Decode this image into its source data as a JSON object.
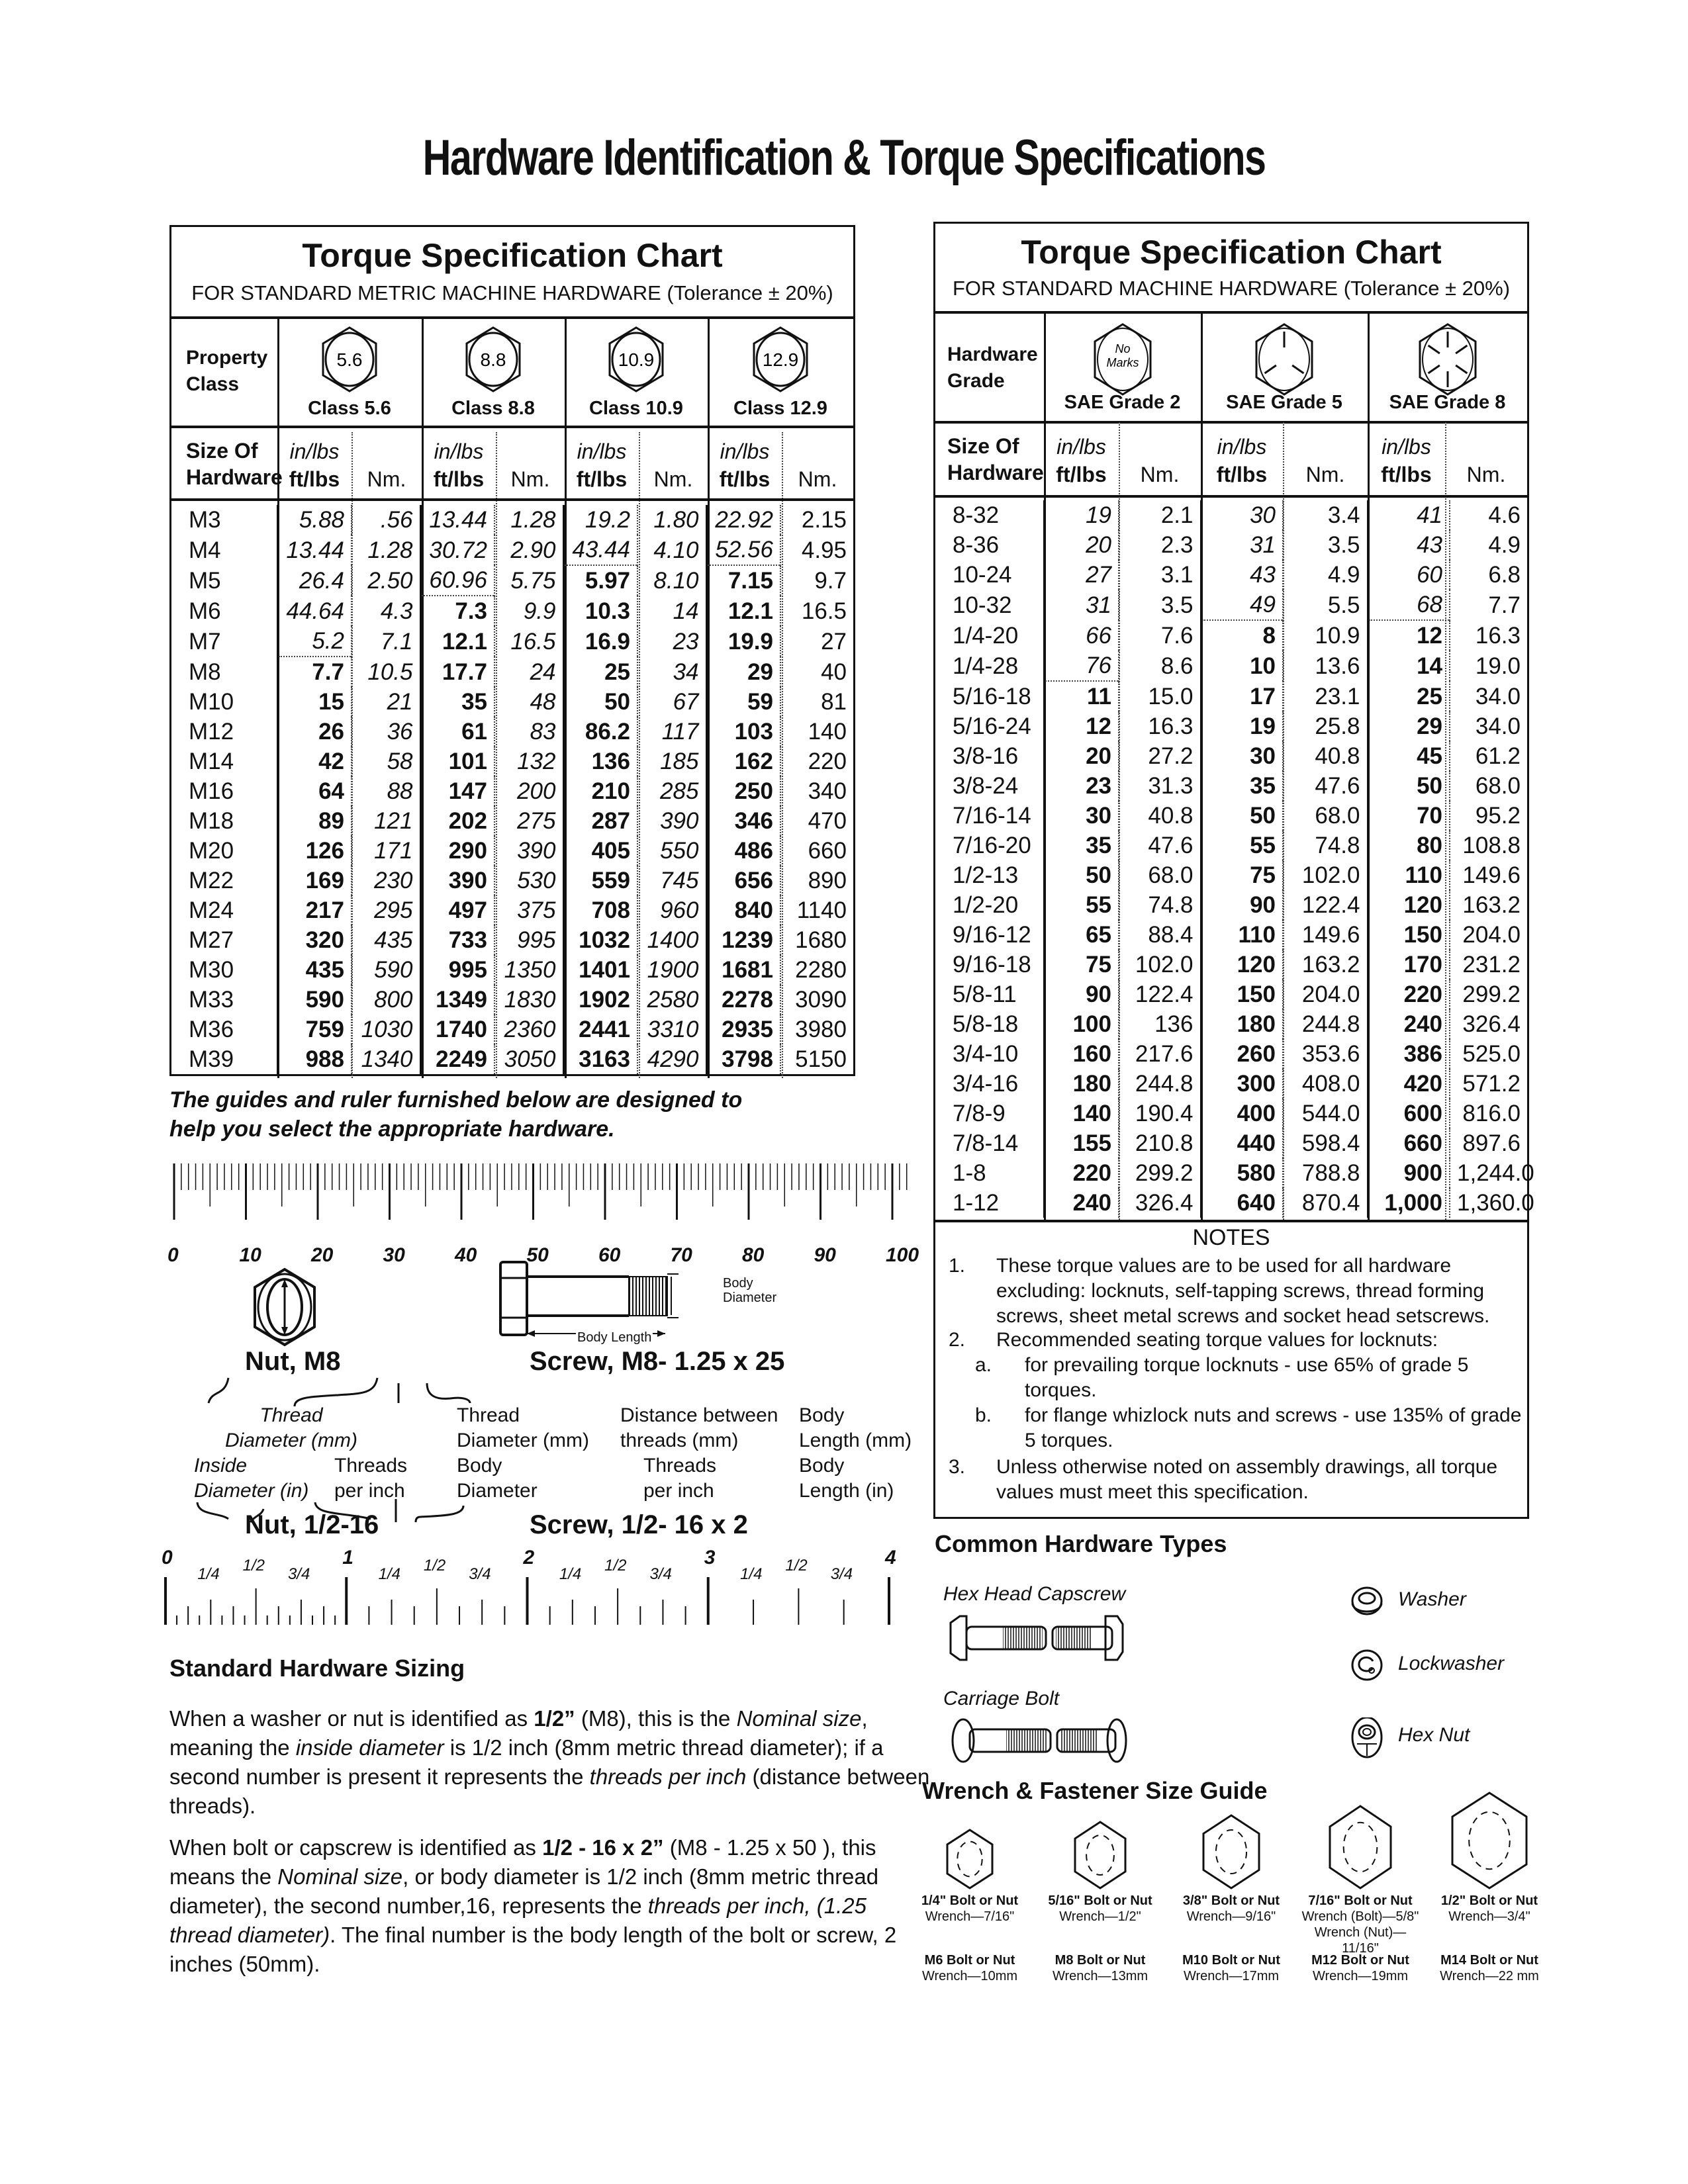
{
  "page": {
    "title": "Hardware Identification  &  Torque Specifications"
  },
  "metric": {
    "title": "Torque Specification Chart",
    "subtitle": "FOR STANDARD METRIC MACHINE HARDWARE (Tolerance ± 20%)",
    "property_label": [
      "Property",
      "Class"
    ],
    "size_label": [
      "Size Of",
      "Hardware"
    ],
    "unit_top": "in/lbs",
    "unit_bottom": "ft/lbs",
    "unit_nm": "Nm.",
    "classes": [
      {
        "mark": "5.6",
        "label": "Class 5.6"
      },
      {
        "mark": "8.8",
        "label": "Class 8.8"
      },
      {
        "mark": "10.9",
        "label": "Class 10.9"
      },
      {
        "mark": "12.9",
        "label": "Class 12.9"
      }
    ],
    "in_lbs_rows_until": [
      5,
      3,
      2,
      2
    ],
    "rows": [
      {
        "size": "M3",
        "v": [
          "5.88",
          ".56",
          "13.44",
          "1.28",
          "19.2",
          "1.80",
          "22.92",
          "2.15"
        ]
      },
      {
        "size": "M4",
        "v": [
          "13.44",
          "1.28",
          "30.72",
          "2.90",
          "43.44",
          "4.10",
          "52.56",
          "4.95"
        ]
      },
      {
        "size": "M5",
        "v": [
          "26.4",
          "2.50",
          "60.96",
          "5.75",
          "5.97",
          "8.10",
          "7.15",
          "9.7"
        ]
      },
      {
        "size": "M6",
        "v": [
          "44.64",
          "4.3",
          "7.3",
          "9.9",
          "10.3",
          "14",
          "12.1",
          "16.5"
        ]
      },
      {
        "size": "M7",
        "v": [
          "5.2",
          "7.1",
          "12.1",
          "16.5",
          "16.9",
          "23",
          "19.9",
          "27"
        ]
      },
      {
        "size": "M8",
        "v": [
          "7.7",
          "10.5",
          "17.7",
          "24",
          "25",
          "34",
          "29",
          "40"
        ]
      },
      {
        "size": "M10",
        "v": [
          "15",
          "21",
          "35",
          "48",
          "50",
          "67",
          "59",
          "81"
        ]
      },
      {
        "size": "M12",
        "v": [
          "26",
          "36",
          "61",
          "83",
          "86.2",
          "117",
          "103",
          "140"
        ]
      },
      {
        "size": "M14",
        "v": [
          "42",
          "58",
          "101",
          "132",
          "136",
          "185",
          "162",
          "220"
        ]
      },
      {
        "size": "M16",
        "v": [
          "64",
          "88",
          "147",
          "200",
          "210",
          "285",
          "250",
          "340"
        ]
      },
      {
        "size": "M18",
        "v": [
          "89",
          "121",
          "202",
          "275",
          "287",
          "390",
          "346",
          "470"
        ]
      },
      {
        "size": "M20",
        "v": [
          "126",
          "171",
          "290",
          "390",
          "405",
          "550",
          "486",
          "660"
        ]
      },
      {
        "size": "M22",
        "v": [
          "169",
          "230",
          "390",
          "530",
          "559",
          "745",
          "656",
          "890"
        ]
      },
      {
        "size": "M24",
        "v": [
          "217",
          "295",
          "497",
          "375",
          "708",
          "960",
          "840",
          "1140"
        ]
      },
      {
        "size": "M27",
        "v": [
          "320",
          "435",
          "733",
          "995",
          "1032",
          "1400",
          "1239",
          "1680"
        ]
      },
      {
        "size": "M30",
        "v": [
          "435",
          "590",
          "995",
          "1350",
          "1401",
          "1900",
          "1681",
          "2280"
        ]
      },
      {
        "size": "M33",
        "v": [
          "590",
          "800",
          "1349",
          "1830",
          "1902",
          "2580",
          "2278",
          "3090"
        ]
      },
      {
        "size": "M36",
        "v": [
          "759",
          "1030",
          "1740",
          "2360",
          "2441",
          "3310",
          "2935",
          "3980"
        ]
      },
      {
        "size": "M39",
        "v": [
          "988",
          "1340",
          "2249",
          "3050",
          "3163",
          "4290",
          "3798",
          "5150"
        ]
      }
    ]
  },
  "sae": {
    "title": "Torque Specification Chart",
    "subtitle": "FOR STANDARD MACHINE HARDWARE (Tolerance ± 20%)",
    "grade_label": [
      "Hardware",
      "Grade"
    ],
    "size_label": [
      "Size Of",
      "Hardware"
    ],
    "unit_top": "in/lbs",
    "unit_bottom": "ft/lbs",
    "unit_nm": "Nm.",
    "no_marks": [
      "No",
      "Marks"
    ],
    "grades": [
      {
        "label": "SAE Grade 2",
        "icon": "no-marks"
      },
      {
        "label": "SAE Grade 5",
        "icon": "three-lines"
      },
      {
        "label": "SAE Grade 8",
        "icon": "six-lines"
      }
    ],
    "in_lbs_rows_until": [
      6,
      4,
      4
    ],
    "rows": [
      {
        "size": "8-32",
        "v": [
          "19",
          "2.1",
          "30",
          "3.4",
          "41",
          "4.6"
        ]
      },
      {
        "size": "8-36",
        "v": [
          "20",
          "2.3",
          "31",
          "3.5",
          "43",
          "4.9"
        ]
      },
      {
        "size": "10-24",
        "v": [
          "27",
          "3.1",
          "43",
          "4.9",
          "60",
          "6.8"
        ]
      },
      {
        "size": "10-32",
        "v": [
          "31",
          "3.5",
          "49",
          "5.5",
          "68",
          "7.7"
        ]
      },
      {
        "size": "1/4-20",
        "v": [
          "66",
          "7.6",
          "8",
          "10.9",
          "12",
          "16.3"
        ]
      },
      {
        "size": "1/4-28",
        "v": [
          "76",
          "8.6",
          "10",
          "13.6",
          "14",
          "19.0"
        ]
      },
      {
        "size": "5/16-18",
        "v": [
          "11",
          "15.0",
          "17",
          "23.1",
          "25",
          "34.0"
        ]
      },
      {
        "size": "5/16-24",
        "v": [
          "12",
          "16.3",
          "19",
          "25.8",
          "29",
          "34.0"
        ]
      },
      {
        "size": "3/8-16",
        "v": [
          "20",
          "27.2",
          "30",
          "40.8",
          "45",
          "61.2"
        ]
      },
      {
        "size": "3/8-24",
        "v": [
          "23",
          "31.3",
          "35",
          "47.6",
          "50",
          "68.0"
        ]
      },
      {
        "size": "7/16-14",
        "v": [
          "30",
          "40.8",
          "50",
          "68.0",
          "70",
          "95.2"
        ]
      },
      {
        "size": "7/16-20",
        "v": [
          "35",
          "47.6",
          "55",
          "74.8",
          "80",
          "108.8"
        ]
      },
      {
        "size": "1/2-13",
        "v": [
          "50",
          "68.0",
          "75",
          "102.0",
          "110",
          "149.6"
        ]
      },
      {
        "size": "1/2-20",
        "v": [
          "55",
          "74.8",
          "90",
          "122.4",
          "120",
          "163.2"
        ]
      },
      {
        "size": "9/16-12",
        "v": [
          "65",
          "88.4",
          "110",
          "149.6",
          "150",
          "204.0"
        ]
      },
      {
        "size": "9/16-18",
        "v": [
          "75",
          "102.0",
          "120",
          "163.2",
          "170",
          "231.2"
        ]
      },
      {
        "size": "5/8-11",
        "v": [
          "90",
          "122.4",
          "150",
          "204.0",
          "220",
          "299.2"
        ]
      },
      {
        "size": "5/8-18",
        "v": [
          "100",
          "136",
          "180",
          "244.8",
          "240",
          "326.4"
        ]
      },
      {
        "size": "3/4-10",
        "v": [
          "160",
          "217.6",
          "260",
          "353.6",
          "386",
          "525.0"
        ]
      },
      {
        "size": "3/4-16",
        "v": [
          "180",
          "244.8",
          "300",
          "408.0",
          "420",
          "571.2"
        ]
      },
      {
        "size": "7/8-9",
        "v": [
          "140",
          "190.4",
          "400",
          "544.0",
          "600",
          "816.0"
        ]
      },
      {
        "size": "7/8-14",
        "v": [
          "155",
          "210.8",
          "440",
          "598.4",
          "660",
          "897.6"
        ]
      },
      {
        "size": "1-8",
        "v": [
          "220",
          "299.2",
          "580",
          "788.8",
          "900",
          "1,244.0"
        ]
      },
      {
        "size": "1-12",
        "v": [
          "240",
          "326.4",
          "640",
          "870.4",
          "1,000",
          "1,360.0"
        ]
      }
    ],
    "notes": {
      "title": "NOTES",
      "items": [
        {
          "num": "1.",
          "text": "These torque values are to be used for all hardware excluding: locknuts, self-tapping screws, thread forming screws, sheet metal screws and socket head setscrews."
        },
        {
          "num": "2.",
          "text": "Recommended seating torque values for locknuts:"
        },
        {
          "num": "a.",
          "text": "for prevailing torque locknuts - use 65% of grade 5 torques."
        },
        {
          "num": "b.",
          "text": "for flange whizlock nuts and screws - use 135% of grade 5 torques."
        },
        {
          "num": "3.",
          "text": "Unless otherwise noted on assembly drawings, all torque values must meet this specification."
        }
      ]
    }
  },
  "guides_note": [
    "The guides and ruler furnished below are designed to",
    "help you select the appropriate hardware."
  ],
  "mm_ruler": {
    "labels": [
      "0",
      "10",
      "20",
      "30",
      "40",
      "50",
      "60",
      "70",
      "80",
      "90",
      "100"
    ],
    "unit": "mm",
    "max": 100
  },
  "inch_ruler": {
    "majors": [
      "0",
      "1",
      "2",
      "3",
      "4"
    ],
    "fractions": [
      "1/4",
      "1/2",
      "3/4"
    ],
    "max": 4
  },
  "diagrams": {
    "nut_m8": "Nut, M8",
    "screw_m8": "Screw, M8- 1.25 x 25",
    "body_diameter": [
      "Body",
      "Diameter"
    ],
    "body_length": "Body Length",
    "nut_thread": [
      "Thread",
      "Diameter (mm)"
    ],
    "screw_thread": [
      "Thread",
      "Diameter (mm)"
    ],
    "screw_distance": [
      "Distance between",
      "threads (mm)"
    ],
    "screw_body_length_mm": [
      "Body",
      "Length (mm)"
    ],
    "nut_inside": [
      "Inside",
      "Diameter (in)"
    ],
    "nut_threads": [
      "Threads",
      "per inch"
    ],
    "screw_body_diam": [
      "Body",
      "Diameter"
    ],
    "screw_threads": [
      "Threads",
      "per inch"
    ],
    "screw_body_length_in": [
      "Body",
      "Length (in)"
    ],
    "nut_imperial": "Nut, 1/2-16",
    "screw_imperial": "Screw, 1/2- 16 x 2"
  },
  "sizing": {
    "heading": "Standard Hardware Sizing",
    "p1": [
      {
        "t": "When a washer or nut is identified as "
      },
      {
        "t": "1/2”",
        "b": true
      },
      {
        "t": " (M8), this is the "
      },
      {
        "t": "Nominal size",
        "i": true
      },
      {
        "t": ", meaning the "
      },
      {
        "t": "inside diameter",
        "i": true
      },
      {
        "t": " is 1/2 inch (8mm metric thread diameter); if a second number is present it represents the "
      },
      {
        "t": "threads per inch",
        "i": true
      },
      {
        "t": " (distance between threads)."
      }
    ],
    "p2": [
      {
        "t": "When bolt or capscrew is identified as "
      },
      {
        "t": "1/2 - 16 x 2”",
        "b": true
      },
      {
        "t": " (M8 - 1.25 x 50 ), this means the "
      },
      {
        "t": "Nominal size",
        "i": true
      },
      {
        "t": ", or body diameter is 1/2 inch (8mm metric thread diameter), the second number,16, represents the "
      },
      {
        "t": "threads per inch, (1.25 thread diameter)",
        "i": true
      },
      {
        "t": ". The final number is the body length of the bolt or screw, 2 inches (50mm)."
      }
    ]
  },
  "common_types": {
    "heading": "Common Hardware Types",
    "items": [
      "Hex Head Capscrew",
      "Carriage Bolt",
      "Washer",
      "Lockwasher",
      "Hex Nut"
    ]
  },
  "wrench_guide": {
    "heading": "Wrench & Fastener Size Guide",
    "items": [
      {
        "imperial": "1/4\" Bolt or Nut",
        "wrench": [
          "Wrench—7/16\""
        ],
        "metric": "M6 Bolt or Nut",
        "metric_wrench": "Wrench—10mm"
      },
      {
        "imperial": "5/16\" Bolt or Nut",
        "wrench": [
          "Wrench—1/2\""
        ],
        "metric": "M8 Bolt or Nut",
        "metric_wrench": "Wrench—13mm"
      },
      {
        "imperial": "3/8\" Bolt or Nut",
        "wrench": [
          "Wrench—9/16\""
        ],
        "metric": "M10 Bolt or Nut",
        "metric_wrench": "Wrench—17mm"
      },
      {
        "imperial": "7/16\" Bolt or Nut",
        "wrench": [
          "Wrench (Bolt)—5/8\"",
          "Wrench (Nut)—11/16\""
        ],
        "metric": "M12 Bolt or Nut",
        "metric_wrench": "Wrench—19mm"
      },
      {
        "imperial": "1/2\" Bolt or Nut",
        "wrench": [
          "Wrench—3/4\""
        ],
        "metric": "M14 Bolt or Nut",
        "metric_wrench": "Wrench—22 mm"
      }
    ]
  }
}
